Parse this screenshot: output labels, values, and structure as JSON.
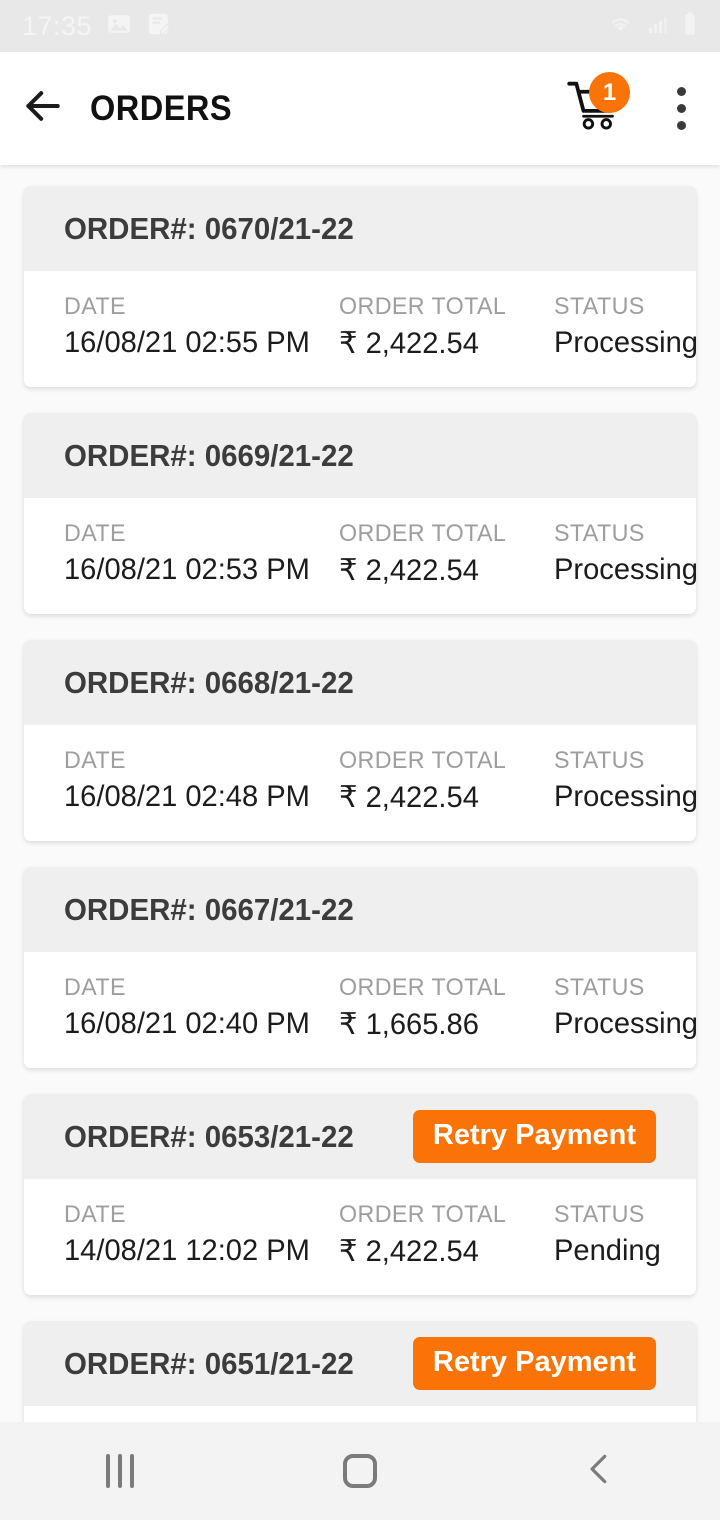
{
  "status_bar": {
    "time": "17:35",
    "left_icons": [
      "gallery-icon",
      "note-edit-icon"
    ],
    "right_icons": [
      "wifi-icon",
      "cellular-signal-icon",
      "battery-icon"
    ]
  },
  "app_bar": {
    "back_icon": "back-arrow-icon",
    "title": "ORDERS",
    "cart_icon": "shopping-cart-icon",
    "cart_badge_count": "1",
    "overflow_icon": "more-vertical-icon",
    "accent_color": "#F97306"
  },
  "labels": {
    "date": "DATE",
    "order_total": "ORDER TOTAL",
    "status": "STATUS",
    "retry_payment": "Retry Payment"
  },
  "orders": [
    {
      "order_no": "ORDER#: 0670/21-22",
      "date": "16/08/21 02:55 PM",
      "total": "₹ 2,422.54",
      "status": "Processing",
      "retry": false
    },
    {
      "order_no": "ORDER#: 0669/21-22",
      "date": "16/08/21 02:53 PM",
      "total": "₹ 2,422.54",
      "status": "Processing",
      "retry": false
    },
    {
      "order_no": "ORDER#: 0668/21-22",
      "date": "16/08/21 02:48 PM",
      "total": "₹ 2,422.54",
      "status": "Processing",
      "retry": false
    },
    {
      "order_no": "ORDER#: 0667/21-22",
      "date": "16/08/21 02:40 PM",
      "total": "₹ 1,665.86",
      "status": "Processing",
      "retry": false
    },
    {
      "order_no": "ORDER#: 0653/21-22",
      "date": "14/08/21 12:02 PM",
      "total": "₹ 2,422.54",
      "status": "Pending",
      "retry": true
    },
    {
      "order_no": "ORDER#: 0651/21-22",
      "date": "",
      "total": "",
      "status": "",
      "retry": true
    }
  ],
  "nav_bar": {
    "recents_icon": "recents-icon",
    "home_icon": "home-icon",
    "back_icon": "back-chevron-icon"
  }
}
